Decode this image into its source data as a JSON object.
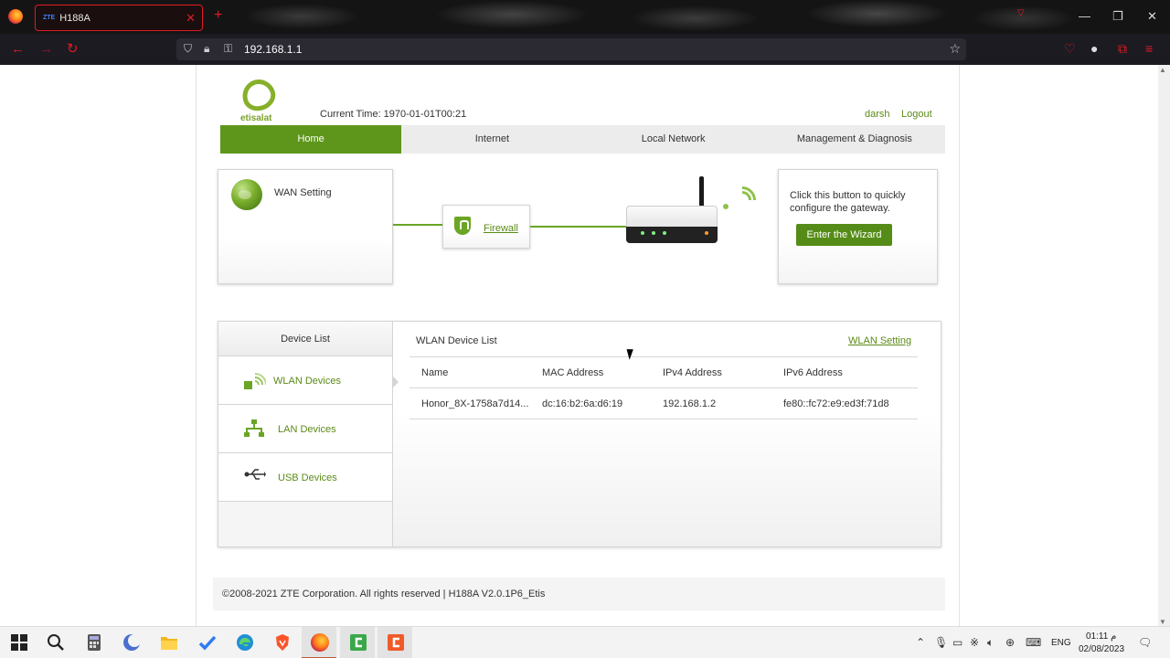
{
  "browser": {
    "tab_favicon": "ZTE",
    "tab_title": "H188A",
    "tab_close": "✕",
    "new_tab": "+",
    "url": "192.168.1.1"
  },
  "router": {
    "logo_text": "etisalat",
    "current_time_label": "Current Time: 1970-01-01T00:21",
    "user": "darsh",
    "logout": "Logout",
    "menu": [
      {
        "label": "Home",
        "active": true
      },
      {
        "label": "Internet"
      },
      {
        "label": "Local Network"
      },
      {
        "label": "Management & Diagnosis"
      }
    ],
    "wan_setting": "WAN Setting",
    "firewall": "Firewall",
    "wizard_text": "Click this button to quickly configure the gateway.",
    "wizard_button": "Enter the Wizard",
    "device_list": {
      "header": "Device List",
      "items": [
        {
          "label": "WLAN Devices",
          "icon": "wifi-signal-icon"
        },
        {
          "label": "LAN Devices",
          "icon": "network-tree-icon"
        },
        {
          "label": "USB Devices",
          "icon": "usb-icon"
        }
      ]
    },
    "wlan_list": {
      "title": "WLAN Device List",
      "setting_link": "WLAN Setting",
      "columns": [
        "Name",
        "MAC Address",
        "IPv4 Address",
        "IPv6 Address"
      ],
      "rows": [
        [
          "Honor_8X-1758a7d14...",
          "dc:16:b2:6a:d6:19",
          "192.168.1.2",
          "fe80::fc72:e9:ed3f:71d8"
        ]
      ]
    },
    "footer": "©2008-2021 ZTE Corporation. All rights reserved  |   H188A V2.0.1P6_Etis"
  },
  "taskbar": {
    "lang": "ENG",
    "time": "01:11 م",
    "date": "02/08/2023"
  },
  "colors": {
    "accent_green": "#5e961c",
    "link_green": "#5b8a16",
    "browser_red": "#e01b24"
  }
}
